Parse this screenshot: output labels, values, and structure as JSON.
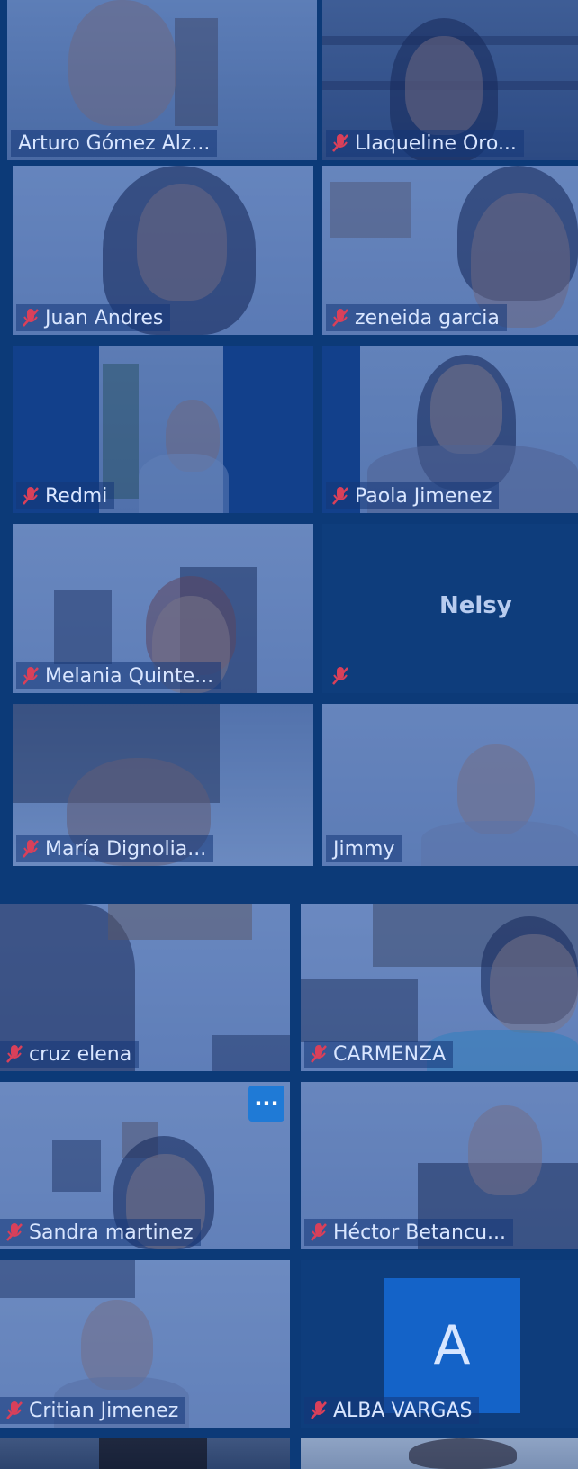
{
  "participants": [
    {
      "name": "Arturo Gómez Alz..."
    },
    {
      "name": "Llaqueline Oro..."
    },
    {
      "name": "Juan Andres"
    },
    {
      "name": "zeneida garcia"
    },
    {
      "name": "Redmi"
    },
    {
      "name": "Paola Jimenez"
    },
    {
      "name": "Melania Quinte..."
    },
    {
      "name": "Nelsy"
    },
    {
      "name": "María Dignolia..."
    },
    {
      "name": "Jimmy"
    },
    {
      "name": "cruz elena"
    },
    {
      "name": "CARMENZA"
    },
    {
      "name": "Sandra martinez"
    },
    {
      "name": "Héctor Betancu..."
    },
    {
      "name": "Critian Jimenez"
    },
    {
      "name": "ALBA VARGAS"
    }
  ],
  "avatar_letter": "A",
  "more_button": "···",
  "colors": {
    "overlay": "#0c3a78",
    "active_border": "#4f9c8f",
    "avatar_bg": "#1463c8",
    "muted_icon": "#d9405a"
  }
}
